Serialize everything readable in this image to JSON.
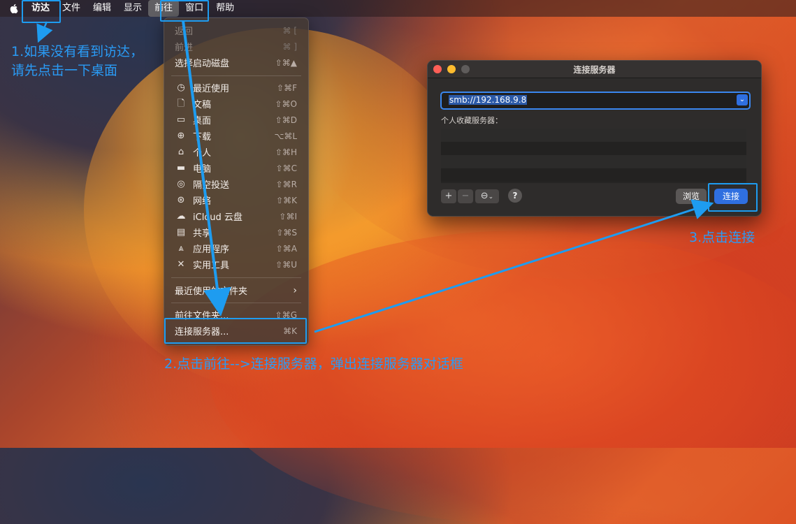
{
  "menubar": {
    "items": [
      "访达",
      "文件",
      "编辑",
      "显示",
      "前往",
      "窗口",
      "帮助"
    ]
  },
  "go_menu": {
    "items": [
      {
        "label": "返回",
        "shortcut": "⌘ [",
        "disabled": true
      },
      {
        "label": "前进",
        "shortcut": "⌘ ]",
        "disabled": true
      },
      {
        "label": "选择启动磁盘",
        "shortcut": "⇧⌘▲"
      },
      {
        "label": "最近使用",
        "shortcut": "⇧⌘F",
        "icon": "clock-icon"
      },
      {
        "label": "文稿",
        "shortcut": "⇧⌘O",
        "icon": "document-icon"
      },
      {
        "label": "桌面",
        "shortcut": "⇧⌘D",
        "icon": "desktop-icon"
      },
      {
        "label": "下载",
        "shortcut": "⌥⌘L",
        "icon": "download-icon"
      },
      {
        "label": "个人",
        "shortcut": "⇧⌘H",
        "icon": "home-icon"
      },
      {
        "label": "电脑",
        "shortcut": "⇧⌘C",
        "icon": "computer-icon"
      },
      {
        "label": "隔空投送",
        "shortcut": "⇧⌘R",
        "icon": "airdrop-icon"
      },
      {
        "label": "网络",
        "shortcut": "⇧⌘K",
        "icon": "network-icon"
      },
      {
        "label": "iCloud 云盘",
        "shortcut": "⇧⌘I",
        "icon": "cloud-icon"
      },
      {
        "label": "共享",
        "shortcut": "⇧⌘S",
        "icon": "shared-folder-icon"
      },
      {
        "label": "应用程序",
        "shortcut": "⇧⌘A",
        "icon": "applications-icon"
      },
      {
        "label": "实用工具",
        "shortcut": "⇧⌘U",
        "icon": "utilities-icon"
      },
      {
        "label": "最近使用的文件夹",
        "shortcut": "",
        "submenu": true
      },
      {
        "label": "前往文件夹...",
        "shortcut": "⇧⌘G"
      },
      {
        "label": "连接服务器...",
        "shortcut": "⌘K"
      }
    ]
  },
  "dialog": {
    "title": "连接服务器",
    "url": "smb://192.168.9.8",
    "favorites_label": "个人收藏服务器：",
    "plus": "+",
    "minus": "−",
    "more": "⊖",
    "help": "?",
    "browse": "浏览",
    "connect": "连接"
  },
  "annotations": {
    "note1_line1": "1.如果没有看到访达，",
    "note1_line2": "请先点击一下桌面",
    "note2": "2.点击前往-->连接服务器，弹出连接服务器对话框",
    "note3": "3.点击连接"
  },
  "colors": {
    "annotation_blue": "#1e9cf0",
    "connect_button": "#2f6fe0",
    "focus_ring": "#3a87f0"
  }
}
